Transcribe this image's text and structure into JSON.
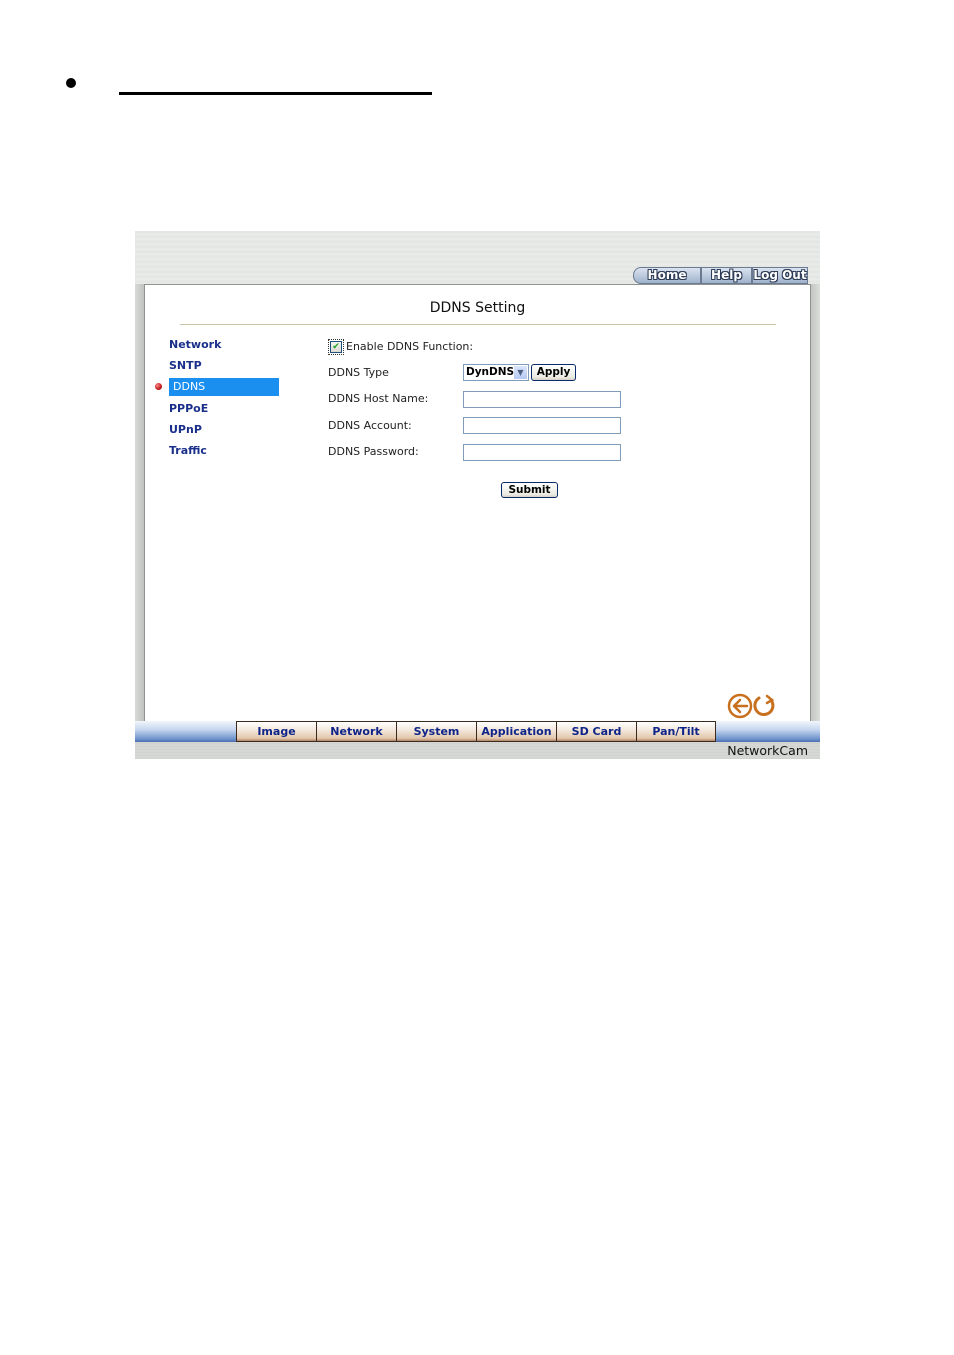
{
  "document": {
    "bullet": "•"
  },
  "header": {
    "nav": [
      {
        "label": "Home"
      },
      {
        "label": "Help"
      },
      {
        "label": "Log Out"
      }
    ]
  },
  "page": {
    "title": "DDNS Setting"
  },
  "sidebar": {
    "items": [
      {
        "label": "Network",
        "active": false
      },
      {
        "label": "SNTP",
        "active": false
      },
      {
        "label": "DDNS",
        "active": true
      },
      {
        "label": "PPPoE",
        "active": false
      },
      {
        "label": "UPnP",
        "active": false
      },
      {
        "label": "Traffic",
        "active": false
      }
    ]
  },
  "form": {
    "enable_label": "Enable DDNS Function:",
    "enable_checked": true,
    "type_label": "DDNS Type",
    "type_value": "DynDNS",
    "apply_label": "Apply",
    "host_label": "DDNS Host Name:",
    "host_value": "",
    "account_label": "DDNS Account:",
    "account_value": "",
    "password_label": "DDNS Password:",
    "password_value": "",
    "submit_label": "Submit"
  },
  "actions": {
    "back_icon": "back-arrow-icon",
    "refresh_icon": "refresh-icon"
  },
  "bottom_nav": {
    "tabs": [
      {
        "label": "Image"
      },
      {
        "label": "Network"
      },
      {
        "label": "System"
      },
      {
        "label": "Application"
      },
      {
        "label": "SD Card"
      },
      {
        "label": "Pan/Tilt"
      }
    ]
  },
  "footer": {
    "brand": "NetworkCam"
  },
  "colors": {
    "active_menu": "#1a8ff0",
    "menu_text": "#1a2f8a",
    "tab_text": "#0e2488",
    "icon_orange": "#c8701e"
  }
}
